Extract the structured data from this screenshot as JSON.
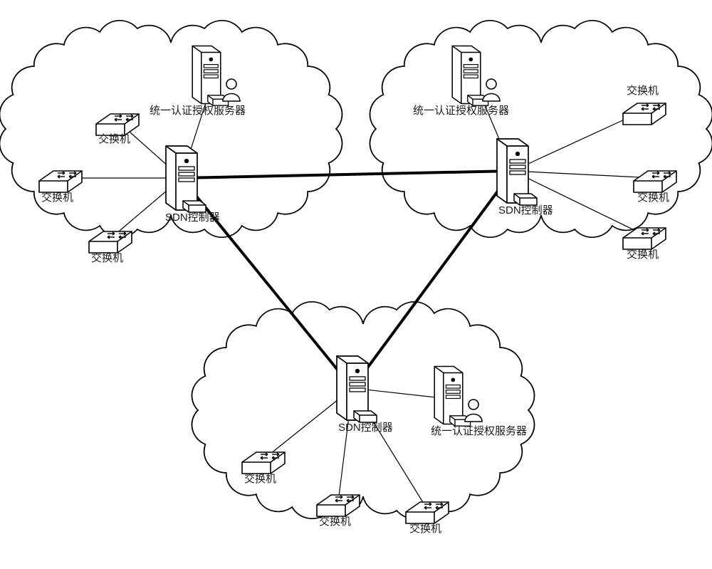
{
  "labels": {
    "sdn_controller": "SDN控制器",
    "auth_server": "统一认证授权服务器",
    "switch": "交换机"
  },
  "diagram": {
    "clouds": 3,
    "description": "Three SDN domains (clouds), each with one SDN controller connected to three switches and one unified authentication/authorization server; the three SDN controllers are interconnected in a triangle."
  }
}
